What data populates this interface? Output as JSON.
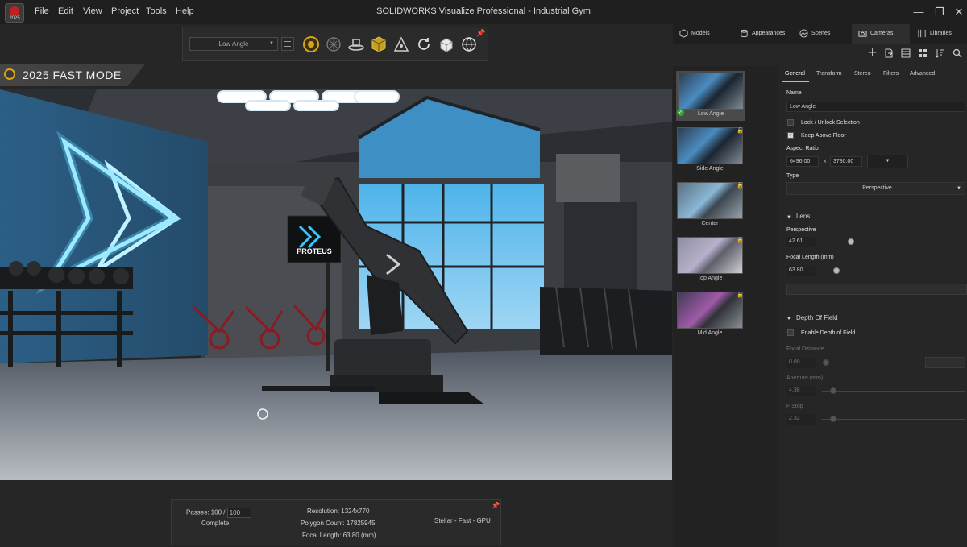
{
  "app": {
    "year": "2025",
    "title": "SOLIDWORKS Visualize Professional - Industrial Gym",
    "menu": [
      "File",
      "Edit",
      "View",
      "Project",
      "Tools",
      "Help"
    ]
  },
  "toolbar": {
    "camera_select": "Low Angle",
    "icons": [
      "render-mode-icon",
      "brain-icon",
      "floor-icon",
      "cube-icon",
      "axis-icon",
      "rotate-icon",
      "box-icon",
      "globe-icon"
    ]
  },
  "fast_mode": {
    "label": "2025 FAST MODE",
    "accent": "#d6a514"
  },
  "stats": {
    "passes_label": "Passes: 100 /",
    "passes_max": "100",
    "status": "Complete",
    "resolution": "Resolution: 1324x770",
    "polygon_count": "Polygon Count: 17825945",
    "focal_length": "Focal Length: 63.80 (mm)",
    "renderer": "Stellar - Fast - GPU"
  },
  "panel_tabs": [
    {
      "label": "Models",
      "icon": "cube-icon"
    },
    {
      "label": "Appearances",
      "icon": "cylinder-icon"
    },
    {
      "label": "Scenes",
      "icon": "scene-icon"
    },
    {
      "label": "Cameras",
      "icon": "camera-icon"
    },
    {
      "label": "Libraries",
      "icon": "library-icon"
    }
  ],
  "panel_icons": [
    "plus-icon",
    "import-icon",
    "layout-icon",
    "grid-icon",
    "sort-icon",
    "search-icon"
  ],
  "cameras": [
    {
      "label": "Low Angle",
      "selected": true
    },
    {
      "label": "Side Angle",
      "locked": true
    },
    {
      "label": "Center",
      "locked": true
    },
    {
      "label": "Top Angle",
      "locked": true
    },
    {
      "label": "Mid Angle",
      "locked": true
    }
  ],
  "props": {
    "tabs": [
      "General",
      "Transform",
      "Stereo",
      "Filters",
      "Advanced"
    ],
    "name_label": "Name",
    "name_value": "Low Angle",
    "lock_label": "Lock / Unlock Selection",
    "keep_floor_label": "Keep Above Floor",
    "aspect_label": "Aspect Ratio",
    "aspect_w": "6496.00",
    "aspect_x": "x",
    "aspect_h": "3780.00",
    "type_label": "Type",
    "type_value": "Perspective",
    "lens_section": "Lens",
    "perspective_label": "Perspective",
    "perspective_value": "42.61",
    "perspective_level": 0.2,
    "focal_label": "Focal Length (mm)",
    "focal_value": "63.80",
    "focal_level": 0.1,
    "dof_section": "Depth Of Field",
    "dof_enable_label": "Enable Depth of Field",
    "focal_distance_label": "Focal Distance",
    "focal_distance_value": "0.00",
    "aperture_label": "Aperture (mm)",
    "aperture_value": "4.38",
    "aperture_level": 0.08,
    "fstop_label": "F Stop",
    "fstop_value": "2.32",
    "fstop_level": 0.08
  },
  "scene": {
    "sign_text": "PROTEUS"
  }
}
